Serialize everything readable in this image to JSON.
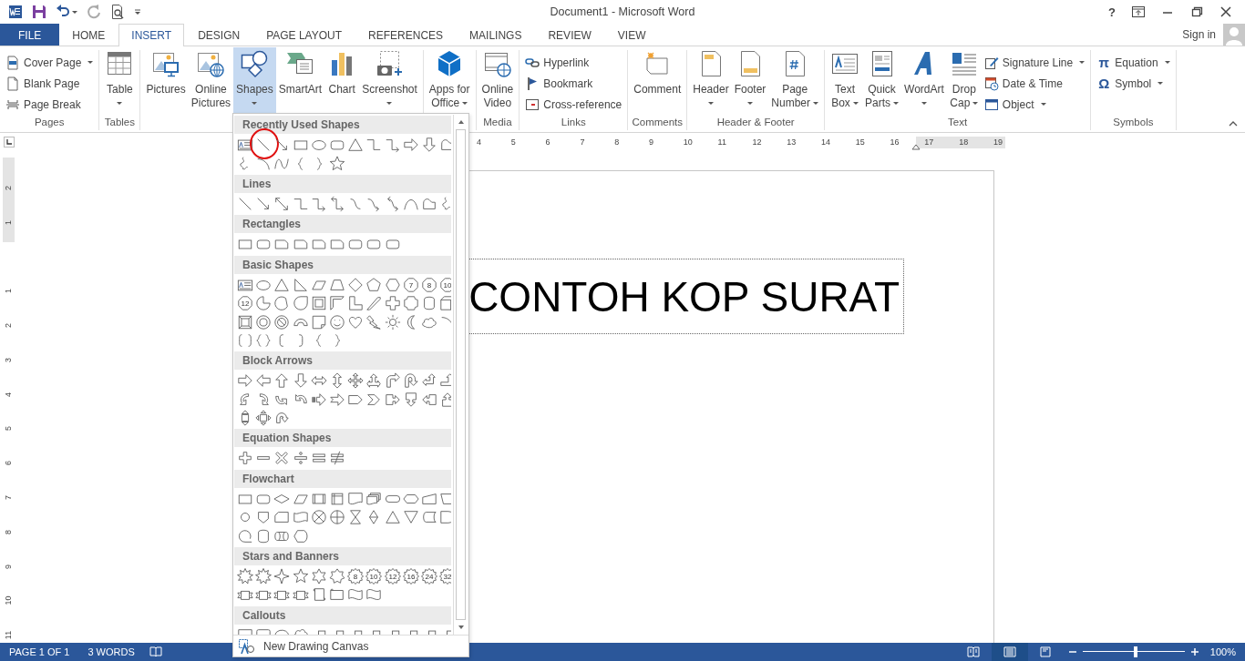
{
  "window": {
    "title": "Document1 - Microsoft Word",
    "help": "?"
  },
  "tabs": [
    {
      "label": "FILE",
      "kind": "file",
      "selected": false
    },
    {
      "label": "HOME",
      "kind": "tab",
      "selected": false
    },
    {
      "label": "INSERT",
      "kind": "tab",
      "selected": true
    },
    {
      "label": "DESIGN",
      "kind": "tab",
      "selected": false
    },
    {
      "label": "PAGE LAYOUT",
      "kind": "tab",
      "selected": false
    },
    {
      "label": "REFERENCES",
      "kind": "tab",
      "selected": false
    },
    {
      "label": "MAILINGS",
      "kind": "tab",
      "selected": false
    },
    {
      "label": "REVIEW",
      "kind": "tab",
      "selected": false
    },
    {
      "label": "VIEW",
      "kind": "tab",
      "selected": false
    }
  ],
  "account": {
    "label": "Sign in"
  },
  "ribbon": {
    "groups": [
      {
        "label": "Pages",
        "buttons": [
          {
            "kind": "small",
            "lines": [
              "Cover Page"
            ],
            "dropdown": true,
            "pressed": false
          },
          {
            "kind": "small",
            "lines": [
              "Blank Page"
            ],
            "dropdown": false,
            "pressed": false
          },
          {
            "kind": "small",
            "lines": [
              "Page Break"
            ],
            "dropdown": false,
            "pressed": false
          }
        ]
      },
      {
        "label": "Tables",
        "buttons": [
          {
            "kind": "large",
            "lines": [
              "Table"
            ],
            "dropdown": true,
            "pressed": false
          }
        ]
      },
      {
        "buttons": [
          {
            "kind": "large",
            "lines": [
              "Pictures"
            ],
            "dropdown": false,
            "pressed": false
          },
          {
            "kind": "large",
            "lines": [
              "Online",
              "Pictures"
            ],
            "dropdown": false,
            "pressed": false
          },
          {
            "kind": "large",
            "lines": [
              "Shapes"
            ],
            "dropdown": true,
            "pressed": true
          },
          {
            "kind": "large",
            "lines": [
              "SmartArt"
            ],
            "dropdown": false,
            "pressed": false
          },
          {
            "kind": "large",
            "lines": [
              "Chart"
            ],
            "dropdown": false,
            "pressed": false
          },
          {
            "kind": "large",
            "lines": [
              "Screenshot"
            ],
            "dropdown": true,
            "pressed": false
          }
        ]
      },
      {
        "buttons": [
          {
            "kind": "large",
            "lines": [
              "Apps for",
              "Office"
            ],
            "dropdown": true,
            "pressed": false
          }
        ]
      },
      {
        "label": "Media",
        "buttons": [
          {
            "kind": "large",
            "lines": [
              "Online",
              "Video"
            ],
            "dropdown": false,
            "pressed": false
          }
        ]
      },
      {
        "label": "Links",
        "buttons": [
          {
            "kind": "small",
            "lines": [
              "Hyperlink"
            ],
            "dropdown": false,
            "pressed": false
          },
          {
            "kind": "small",
            "lines": [
              "Bookmark"
            ],
            "dropdown": false,
            "pressed": false
          },
          {
            "kind": "small",
            "lines": [
              "Cross-reference"
            ],
            "dropdown": false,
            "pressed": false
          }
        ]
      },
      {
        "label": "Comments",
        "buttons": [
          {
            "kind": "large",
            "lines": [
              "Comment"
            ],
            "dropdown": false,
            "pressed": false
          }
        ]
      },
      {
        "label": "Header & Footer",
        "buttons": [
          {
            "kind": "large",
            "lines": [
              "Header"
            ],
            "dropdown": true,
            "pressed": false
          },
          {
            "kind": "large",
            "lines": [
              "Footer"
            ],
            "dropdown": true,
            "pressed": false
          },
          {
            "kind": "large",
            "lines": [
              "Page",
              "Number"
            ],
            "dropdown": true,
            "pressed": false
          }
        ]
      },
      {
        "label": "Text",
        "buttons": [
          {
            "kind": "large",
            "lines": [
              "Text",
              "Box"
            ],
            "dropdown": true,
            "pressed": false
          },
          {
            "kind": "large",
            "lines": [
              "Quick",
              "Parts"
            ],
            "dropdown": true,
            "pressed": false
          },
          {
            "kind": "large",
            "lines": [
              "WordArt"
            ],
            "dropdown": true,
            "pressed": false
          },
          {
            "kind": "large",
            "lines": [
              "Drop",
              "Cap"
            ],
            "dropdown": true,
            "pressed": false
          },
          {
            "kind": "small",
            "lines": [
              "Signature Line"
            ],
            "dropdown": true,
            "pressed": false
          },
          {
            "kind": "small",
            "lines": [
              "Date & Time"
            ],
            "dropdown": false,
            "pressed": false
          },
          {
            "kind": "small",
            "lines": [
              "Object"
            ],
            "dropdown": true,
            "pressed": false
          }
        ]
      },
      {
        "label": "Symbols",
        "buttons": [
          {
            "kind": "small",
            "glyph": "π",
            "lines": [
              "Equation"
            ],
            "dropdown": true,
            "pressed": false
          },
          {
            "kind": "small",
            "glyph": "Ω",
            "lines": [
              "Symbol"
            ],
            "dropdown": true,
            "pressed": false
          }
        ]
      }
    ]
  },
  "shapes_menu": {
    "sections": [
      {
        "title": "Recently Used Shapes",
        "shapes": [
          {
            "kind": "text-box",
            "circled": false
          },
          {
            "kind": "line",
            "circled": true
          },
          {
            "kind": "arrow",
            "circled": false
          },
          {
            "kind": "rectangle",
            "circled": false
          },
          {
            "kind": "oval",
            "circled": false
          },
          {
            "kind": "rounded-rectangle",
            "circled": false
          },
          {
            "kind": "triangle",
            "circled": false
          },
          {
            "kind": "elbow-connector",
            "circled": false
          },
          {
            "kind": "elbow-arrow",
            "circled": false
          },
          {
            "kind": "block-arrow-right",
            "circled": false
          },
          {
            "kind": "block-arrow-down",
            "circled": false
          },
          {
            "kind": "freeform-shape",
            "circled": false
          },
          {
            "kind": "scribble",
            "circled": false
          },
          {
            "kind": "arc",
            "circled": false
          },
          {
            "kind": "wave-curve",
            "circled": false
          },
          {
            "kind": "brace-left",
            "circled": false
          },
          {
            "kind": "brace-right",
            "circled": false
          },
          {
            "kind": "star-5",
            "circled": false
          }
        ]
      },
      {
        "title": "Lines",
        "shapes": [
          {
            "kind": "line"
          },
          {
            "kind": "arrow"
          },
          {
            "kind": "double-arrow"
          },
          {
            "kind": "elbow-connector"
          },
          {
            "kind": "elbow-arrow"
          },
          {
            "kind": "elbow-double-arrow"
          },
          {
            "kind": "curved-connector"
          },
          {
            "kind": "curved-arrow"
          },
          {
            "kind": "curved-double-arrow"
          },
          {
            "kind": "arch-curve"
          },
          {
            "kind": "freeform-shape"
          },
          {
            "kind": "scribble"
          }
        ]
      },
      {
        "title": "Rectangles",
        "shapes": [
          {
            "kind": "rectangle"
          },
          {
            "kind": "rounded-rectangle"
          },
          {
            "kind": "snipped-rectangle"
          },
          {
            "kind": "snipped-rectangle"
          },
          {
            "kind": "snipped-rectangle"
          },
          {
            "kind": "snipped-rectangle"
          },
          {
            "kind": "rounded-rectangle"
          },
          {
            "kind": "rounded-rectangle"
          },
          {
            "kind": "rounded-rectangle"
          }
        ]
      },
      {
        "title": "Basic Shapes",
        "shapes": [
          {
            "kind": "text-box"
          },
          {
            "kind": "oval"
          },
          {
            "kind": "triangle"
          },
          {
            "kind": "right-triangle"
          },
          {
            "kind": "parallelogram"
          },
          {
            "kind": "trapezoid"
          },
          {
            "kind": "diamond"
          },
          {
            "kind": "pentagon"
          },
          {
            "kind": "hexagon"
          },
          {
            "kind": "octagon",
            "label": "7"
          },
          {
            "kind": "octagon",
            "label": "8"
          },
          {
            "kind": "octagon",
            "label": "10"
          },
          {
            "kind": "octagon",
            "label": "12"
          },
          {
            "kind": "pie"
          },
          {
            "kind": "chord"
          },
          {
            "kind": "teardrop"
          },
          {
            "kind": "frame"
          },
          {
            "kind": "half-frame"
          },
          {
            "kind": "l-shape"
          },
          {
            "kind": "diagonal-stripe"
          },
          {
            "kind": "cross"
          },
          {
            "kind": "plaque"
          },
          {
            "kind": "can"
          },
          {
            "kind": "cube"
          },
          {
            "kind": "bevel"
          },
          {
            "kind": "donut"
          },
          {
            "kind": "no-symbol"
          },
          {
            "kind": "block-arc"
          },
          {
            "kind": "folded-corner"
          },
          {
            "kind": "smiley"
          },
          {
            "kind": "heart"
          },
          {
            "kind": "lightning-bolt"
          },
          {
            "kind": "sun"
          },
          {
            "kind": "moon"
          },
          {
            "kind": "cloud"
          },
          {
            "kind": "arc"
          },
          {
            "kind": "bracket-pair"
          },
          {
            "kind": "brace-pair"
          },
          {
            "kind": "bracket-left"
          },
          {
            "kind": "bracket-right"
          },
          {
            "kind": "brace-left"
          },
          {
            "kind": "brace-right"
          }
        ]
      },
      {
        "title": "Block Arrows",
        "shapes": [
          {
            "kind": "block-arrow-right"
          },
          {
            "kind": "block-arrow-left"
          },
          {
            "kind": "block-arrow-up"
          },
          {
            "kind": "block-arrow-down"
          },
          {
            "kind": "left-right-arrow"
          },
          {
            "kind": "up-down-arrow"
          },
          {
            "kind": "quad-arrow"
          },
          {
            "kind": "left-right-up-arrow"
          },
          {
            "kind": "bent-arrow"
          },
          {
            "kind": "u-turn-arrow"
          },
          {
            "kind": "left-up-arrow"
          },
          {
            "kind": "bent-up-arrow"
          },
          {
            "kind": "curved-right-arrow"
          },
          {
            "kind": "curved-left-arrow"
          },
          {
            "kind": "curved-up-arrow"
          },
          {
            "kind": "curved-down-arrow"
          },
          {
            "kind": "striped-right-arrow"
          },
          {
            "kind": "notched-right-arrow"
          },
          {
            "kind": "pentagon-arrow"
          },
          {
            "kind": "chevron"
          },
          {
            "kind": "right-arrow-callout"
          },
          {
            "kind": "down-arrow-callout"
          },
          {
            "kind": "left-arrow-callout"
          },
          {
            "kind": "up-arrow-callout"
          },
          {
            "kind": "up-down-arrow-callout"
          },
          {
            "kind": "quad-arrow-callout"
          },
          {
            "kind": "circular-arrow"
          }
        ]
      },
      {
        "title": "Equation Shapes",
        "shapes": [
          {
            "kind": "plus"
          },
          {
            "kind": "minus"
          },
          {
            "kind": "multiply"
          },
          {
            "kind": "divide"
          },
          {
            "kind": "equal"
          },
          {
            "kind": "not-equal"
          }
        ]
      },
      {
        "title": "Flowchart",
        "shapes": [
          {
            "kind": "rectangle"
          },
          {
            "kind": "rounded-rectangle"
          },
          {
            "kind": "decision"
          },
          {
            "kind": "parallelogram"
          },
          {
            "kind": "predefined-process"
          },
          {
            "kind": "internal-storage"
          },
          {
            "kind": "document"
          },
          {
            "kind": "multidocument"
          },
          {
            "kind": "terminator"
          },
          {
            "kind": "preparation"
          },
          {
            "kind": "manual-input"
          },
          {
            "kind": "manual-operation"
          },
          {
            "kind": "connector"
          },
          {
            "kind": "off-page-connector"
          },
          {
            "kind": "card"
          },
          {
            "kind": "punched-tape"
          },
          {
            "kind": "summing-junction"
          },
          {
            "kind": "or"
          },
          {
            "kind": "collate"
          },
          {
            "kind": "sort"
          },
          {
            "kind": "triangle"
          },
          {
            "kind": "merge"
          },
          {
            "kind": "stored-data"
          },
          {
            "kind": "delay"
          },
          {
            "kind": "sequential-storage"
          },
          {
            "kind": "can"
          },
          {
            "kind": "direct-access-storage"
          },
          {
            "kind": "display"
          }
        ]
      },
      {
        "title": "Stars and Banners",
        "shapes": [
          {
            "kind": "explosion"
          },
          {
            "kind": "explosion"
          },
          {
            "kind": "star-4"
          },
          {
            "kind": "star-5"
          },
          {
            "kind": "star-6"
          },
          {
            "kind": "star-7"
          },
          {
            "kind": "star-burst",
            "label": "8"
          },
          {
            "kind": "star-burst",
            "label": "10"
          },
          {
            "kind": "star-burst",
            "label": "12"
          },
          {
            "kind": "star-burst",
            "label": "16"
          },
          {
            "kind": "star-burst",
            "label": "24"
          },
          {
            "kind": "star-burst",
            "label": "32"
          },
          {
            "kind": "ribbon"
          },
          {
            "kind": "ribbon"
          },
          {
            "kind": "ribbon"
          },
          {
            "kind": "ribbon"
          },
          {
            "kind": "vertical-scroll"
          },
          {
            "kind": "horizontal-scroll"
          },
          {
            "kind": "wave"
          },
          {
            "kind": "wave"
          }
        ]
      },
      {
        "title": "Callouts",
        "shapes": [
          {
            "kind": "rectangular-callout"
          },
          {
            "kind": "rounded-callout"
          },
          {
            "kind": "oval-callout"
          },
          {
            "kind": "cloud-callout"
          },
          {
            "kind": "line-callout"
          },
          {
            "kind": "line-callout"
          },
          {
            "kind": "line-callout"
          },
          {
            "kind": "line-callout"
          },
          {
            "kind": "line-callout"
          },
          {
            "kind": "line-callout"
          },
          {
            "kind": "line-callout"
          },
          {
            "kind": "line-callout"
          }
        ]
      }
    ],
    "footer": {
      "label": "New Drawing Canvas"
    }
  },
  "ruler": {
    "marks": [
      "4",
      "5",
      "6",
      "7",
      "8",
      "9",
      "10",
      "11",
      "12",
      "13",
      "14",
      "15",
      "16",
      "17",
      "18",
      "19"
    ]
  },
  "vertical_ruler": {
    "marks": [
      "2",
      "1",
      "1",
      "2",
      "3",
      "4",
      "5",
      "6",
      "7",
      "8",
      "9",
      "10",
      "11"
    ]
  },
  "document": {
    "text": "CONTOH KOP SURAT"
  },
  "status_bar": {
    "page": "PAGE 1 OF 1",
    "words": "3 WORDS",
    "views": [
      {
        "selected": false
      },
      {
        "selected": true
      },
      {
        "selected": false
      }
    ],
    "zoom": {
      "level": 0.52,
      "reading": "100%"
    }
  }
}
